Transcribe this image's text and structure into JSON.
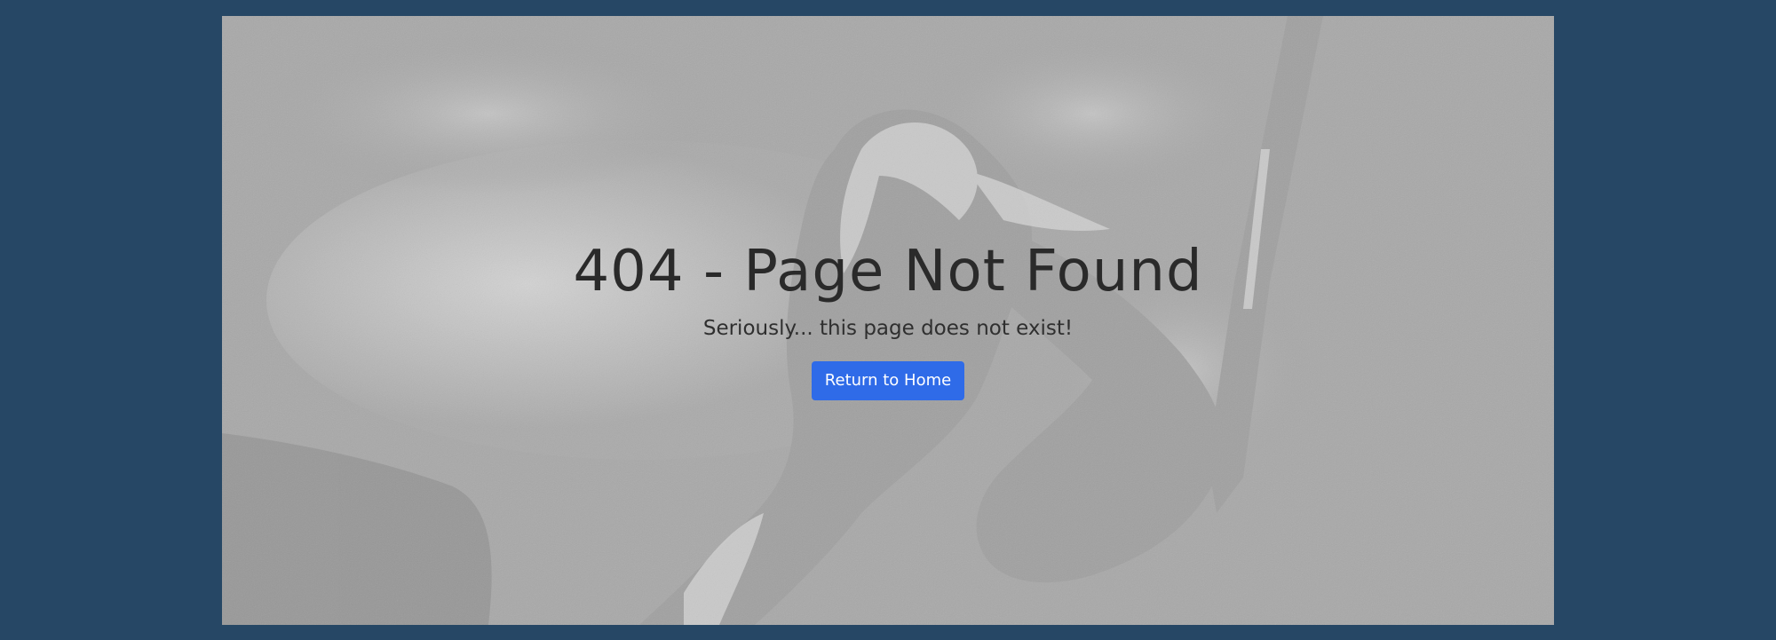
{
  "error_page": {
    "title": "404 - Page Not Found",
    "subtitle": "Seriously... this page does not exist!",
    "button_label": "Return to Home"
  },
  "colors": {
    "page_background": "#264765",
    "button": "#2f6be8",
    "button_text": "#ffffff",
    "title_text": "#2a2a2a"
  }
}
